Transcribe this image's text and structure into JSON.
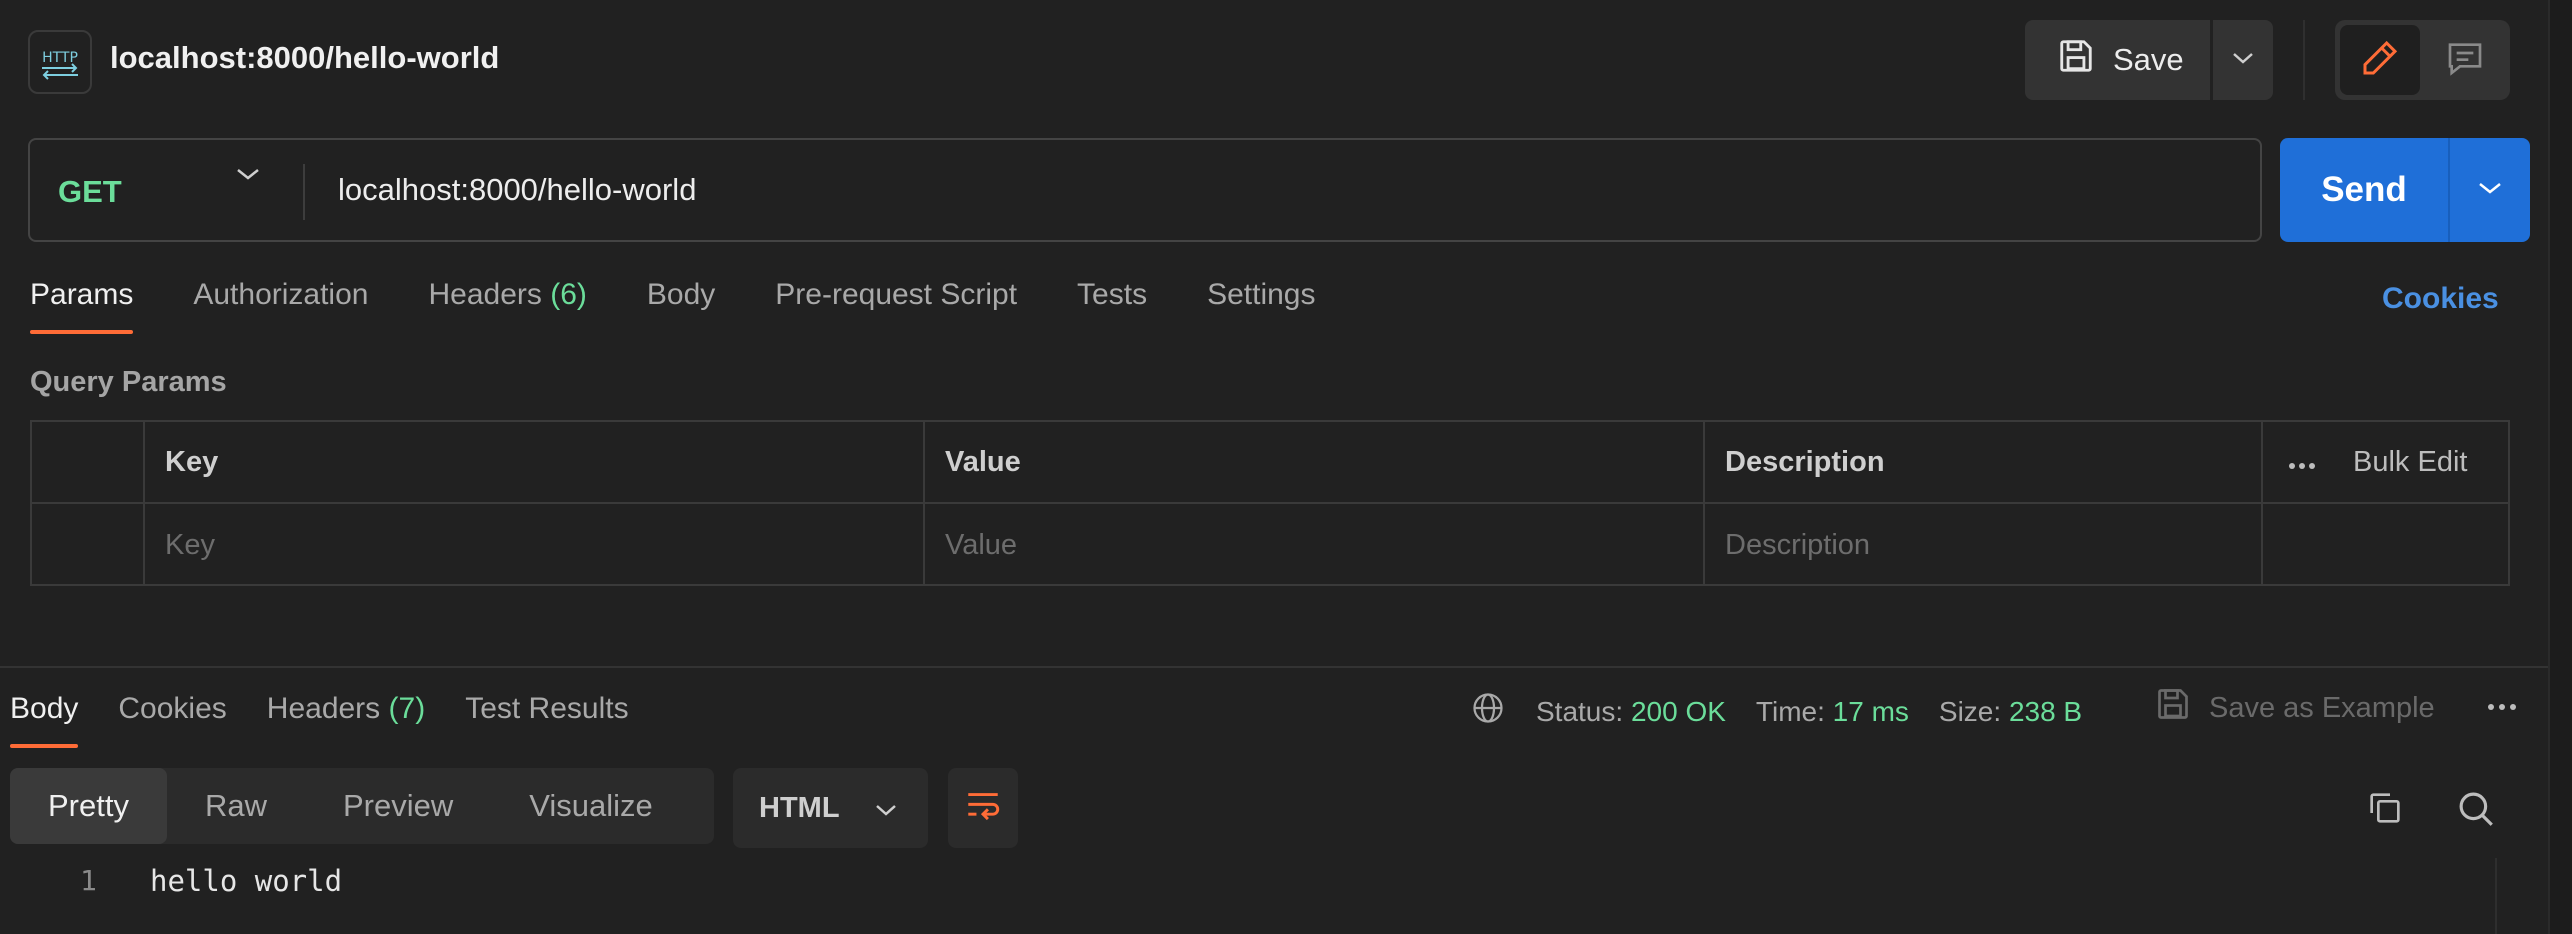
{
  "header": {
    "badge_text": "HTTP",
    "title": "localhost:8000/hello-world",
    "save_label": "Save"
  },
  "request": {
    "method": "GET",
    "url": "localhost:8000/hello-world",
    "send_label": "Send"
  },
  "request_tabs": [
    {
      "label": "Params",
      "active": true
    },
    {
      "label": "Authorization"
    },
    {
      "label": "Headers",
      "count": "(6)"
    },
    {
      "label": "Body"
    },
    {
      "label": "Pre-request Script"
    },
    {
      "label": "Tests"
    },
    {
      "label": "Settings"
    }
  ],
  "cookies_link": "Cookies",
  "params": {
    "section_title": "Query Params",
    "columns": [
      "Key",
      "Value",
      "Description"
    ],
    "bulk_edit": "Bulk Edit",
    "placeholders": [
      "Key",
      "Value",
      "Description"
    ]
  },
  "response_tabs": [
    {
      "label": "Body",
      "active": true
    },
    {
      "label": "Cookies"
    },
    {
      "label": "Headers",
      "count": "(7)"
    },
    {
      "label": "Test Results"
    }
  ],
  "response_status": {
    "status_label": "Status:",
    "status_value": "200 OK",
    "time_label": "Time:",
    "time_value": "17 ms",
    "size_label": "Size:",
    "size_value": "238 B",
    "save_example": "Save as Example"
  },
  "view_tabs": [
    "Pretty",
    "Raw",
    "Preview",
    "Visualize"
  ],
  "format": "HTML",
  "code": {
    "line_number": "1",
    "line_text": "hello world"
  },
  "colors": {
    "accent": "#ff6c37",
    "send": "#1f6fd8",
    "success": "#6bdd9a",
    "link": "#4a90e2"
  }
}
